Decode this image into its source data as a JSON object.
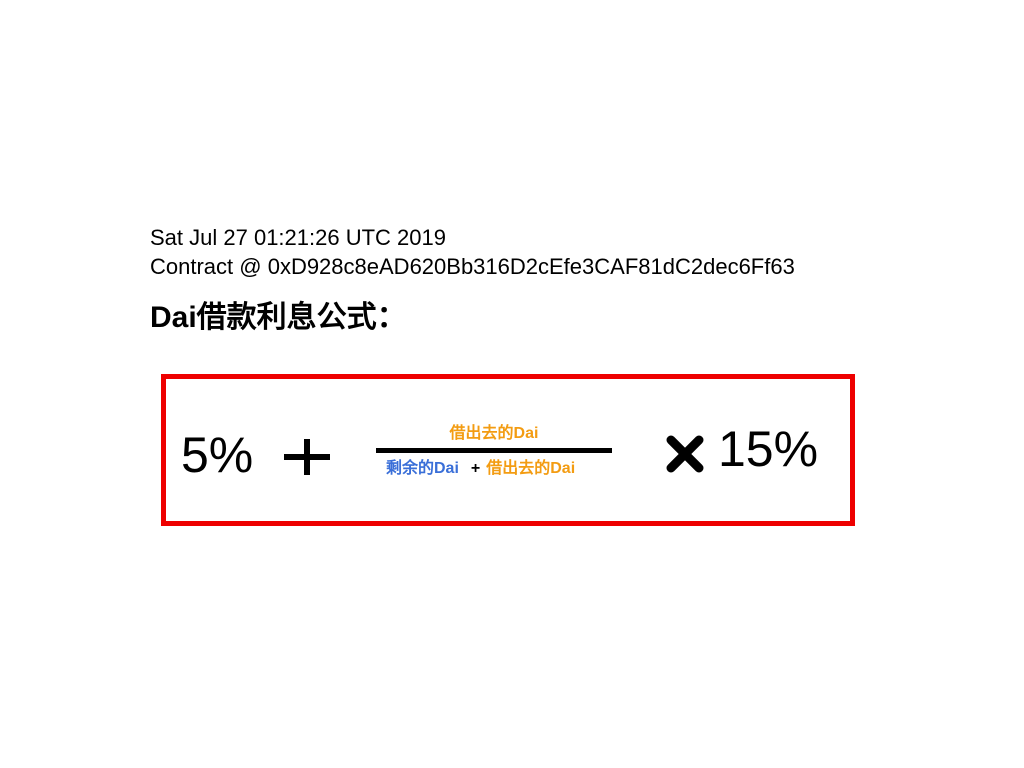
{
  "document": {
    "timestamp": "Sat Jul 27 01:21:26 UTC 2019",
    "contract_line": "Contract @ 0xD928c8eAD620Bb316D2cEfe3CAF81dC2dec6Ff63",
    "title": "Dai借款利息公式："
  },
  "formula": {
    "base_rate": "5%",
    "plus_icon": "plus-icon",
    "numerator": "借出去的Dai",
    "denominator_left": "剩余的Dai",
    "denominator_plus": "+",
    "denominator_right": "借出去的Dai",
    "times_icon": "times-icon",
    "multiplier": "15%"
  },
  "colors": {
    "box_border": "#ee0000",
    "orange_text": "#f39c12",
    "blue_text": "#3a6fd8"
  }
}
